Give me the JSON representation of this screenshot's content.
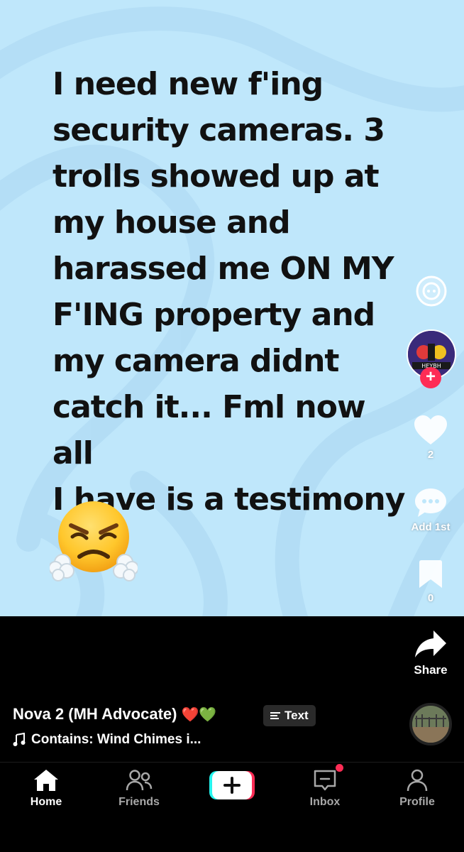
{
  "post": {
    "text": "I need new f'ing\nsecurity cameras. 3\ntrolls showed up at\nmy house and\nharassed me ON MY\nF'ING property and\nmy camera didnt\ncatch it... Fml now all\nI have is a testimony",
    "emoji": "face-with-steam-from-nose",
    "background_color": "#bfe7fb"
  },
  "actions": {
    "likes": "2",
    "comments": "Add 1st",
    "saves": "0",
    "share": "Share"
  },
  "caption": {
    "name": "Nova 2 (MH Advocate)",
    "hearts": "❤️💚",
    "text_badge": "Text",
    "sound": "Contains: Wind Chimes i..."
  },
  "tabs": [
    {
      "label": "Home",
      "icon": "home-icon"
    },
    {
      "label": "Friends",
      "icon": "friends-icon"
    },
    {
      "label": "Create",
      "icon": "plus-icon"
    },
    {
      "label": "Inbox",
      "icon": "inbox-icon"
    },
    {
      "label": "Profile",
      "icon": "profile-icon"
    }
  ],
  "colors": {
    "accent_red": "#fe2c55",
    "accent_cyan": "#25f4ee"
  }
}
